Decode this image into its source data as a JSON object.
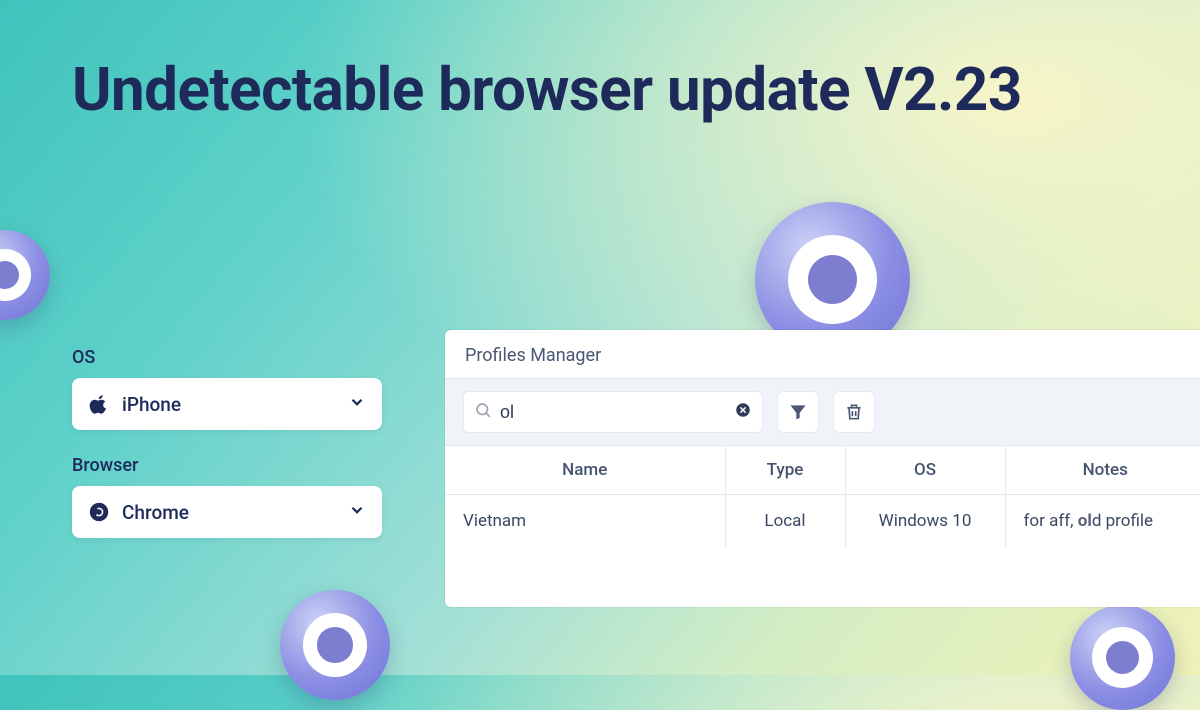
{
  "title": "Undetectable browser update V2.23",
  "selectors": {
    "os": {
      "label": "OS",
      "value": "iPhone",
      "icon": "apple-icon"
    },
    "browser": {
      "label": "Browser",
      "value": "Chrome",
      "icon": "chrome-icon"
    }
  },
  "panel": {
    "title": "Profiles Manager",
    "search": {
      "value": "ol",
      "placeholder": ""
    },
    "columns": [
      "Name",
      "Type",
      "OS",
      "Notes"
    ],
    "rows": [
      {
        "name": "Vietnam",
        "type": "Local",
        "os": "Windows 10",
        "notes_pre": "for aff, ",
        "notes_hl": "ol",
        "notes_post": "d profile"
      }
    ]
  }
}
